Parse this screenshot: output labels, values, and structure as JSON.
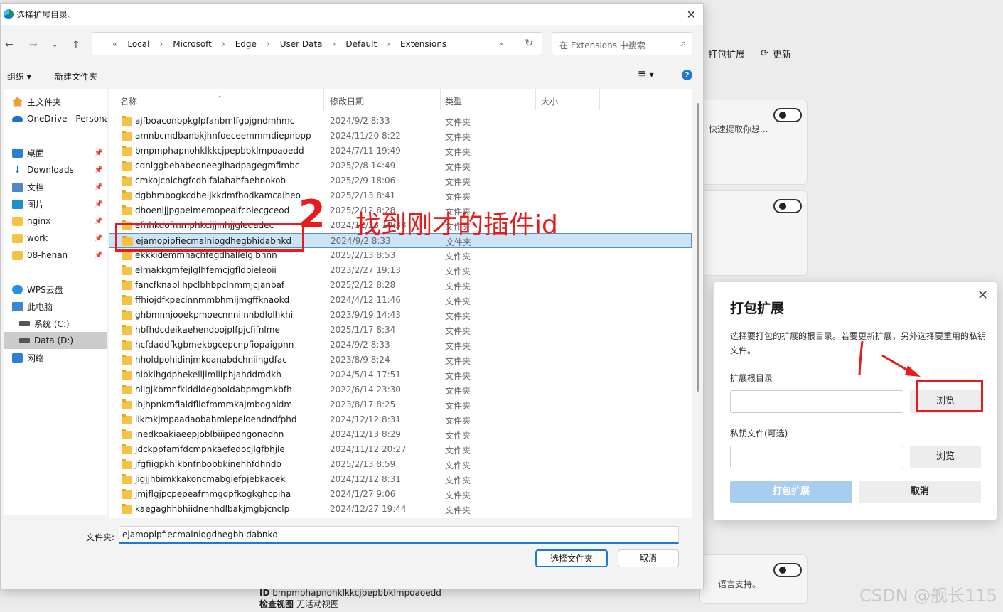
{
  "background": {
    "toolbar": {
      "pack_label": "打包扩展",
      "refresh_label": "更新"
    },
    "card_desc_1": "快速提取你想...",
    "card_desc_last": "语言支持。",
    "bottom_id_label": "ID",
    "bottom_id_value": "bmpmphapnohklkkcjpepbbklmpoaoedd",
    "bottom_view_label": "检查视图",
    "bottom_view_value": "无活动视图",
    "watermark": "CSDN @舰长115"
  },
  "dialog": {
    "title": "选择扩展目录。",
    "breadcrumb": [
      "Local",
      "Microsoft",
      "Edge",
      "User Data",
      "Default",
      "Extensions"
    ],
    "breadcrumb_prefix": "«",
    "search_placeholder": "在 Extensions 中搜索",
    "organize_label": "组织 ▾",
    "new_folder_label": "新建文件夹",
    "columns": {
      "name": "名称",
      "modified": "修改日期",
      "type": "类型",
      "size": "大小"
    },
    "nav": [
      {
        "label": "主文件夹",
        "icon": "home-icon"
      },
      {
        "label": "OneDrive - Personal",
        "icon": "onedrive-icon"
      },
      {
        "label": "桌面",
        "icon": "desktop-icon",
        "pinned": true
      },
      {
        "label": "Downloads",
        "icon": "download-icon",
        "pinned": true
      },
      {
        "label": "文档",
        "icon": "document-icon",
        "pinned": true
      },
      {
        "label": "图片",
        "icon": "pictures-icon",
        "pinned": true
      },
      {
        "label": "nginx",
        "icon": "folder-icon",
        "pinned": true
      },
      {
        "label": "work",
        "icon": "folder-icon",
        "pinned": true
      },
      {
        "label": "08-henan",
        "icon": "folder-icon",
        "pinned": true
      },
      {
        "label": "WPS云盘",
        "icon": "wps-cloud-icon"
      },
      {
        "label": "此电脑",
        "icon": "pc-icon"
      },
      {
        "label": "系统 (C:)",
        "icon": "drive-icon"
      },
      {
        "label": "Data (D:)",
        "icon": "drive-icon",
        "selected": true
      },
      {
        "label": "网络",
        "icon": "network-icon"
      }
    ],
    "files": [
      {
        "name": "ajfboaconbpkglpfanbmlfgojgndmhmc",
        "date": "2024/9/2 8:33",
        "type": "文件夹"
      },
      {
        "name": "amnbcmdbanbkjhnfoeceemmmdiepnbpp",
        "date": "2024/11/20 8:22",
        "type": "文件夹"
      },
      {
        "name": "bmpmphapnohklkkcjpepbbklmpoaoedd",
        "date": "2024/7/11 19:49",
        "type": "文件夹"
      },
      {
        "name": "cdnlggbebabeoneeglhadpagegmflmbc",
        "date": "2025/2/8 14:49",
        "type": "文件夹"
      },
      {
        "name": "cmkojcnichgfcdhlfalahahfaehnokob",
        "date": "2025/2/9 18:06",
        "type": "文件夹"
      },
      {
        "name": "dgbhmbogkcdheijkkdmfhodkamcaiheo",
        "date": "2025/2/13 8:41",
        "type": "文件夹"
      },
      {
        "name": "dhoenijjpgpeimemopealfcbiecgceod",
        "date": "2025/2/12 8:28",
        "type": "文件夹"
      },
      {
        "name": "efnhkdofmmphkcijjinhjjgledadec",
        "date": "2024/12/23 10:38",
        "type": "文件夹"
      },
      {
        "name": "ejamopipfiecmalniogdhegbhidabnkd",
        "date": "2024/9/2 8:33",
        "type": "文件夹",
        "selected": true
      },
      {
        "name": "ekkkidemmhachfegdhallelgibnnn",
        "date": "2025/2/13 8:53",
        "type": "文件夹"
      },
      {
        "name": "elmakkgmfejlglhfemcjgfldbieleoii",
        "date": "2023/2/27 19:13",
        "type": "文件夹"
      },
      {
        "name": "fancfknaplihpclbhbpclnmmjcjanbaf",
        "date": "2025/2/12 8:28",
        "type": "文件夹"
      },
      {
        "name": "ffhiojdfkpecinnmmbhmijmgffknaokd",
        "date": "2024/4/12 11:46",
        "type": "文件夹"
      },
      {
        "name": "ghbmnnjooekpmoecnnnilnnbdlolhkhi",
        "date": "2023/9/19 14:43",
        "type": "文件夹"
      },
      {
        "name": "hbfhdcdeikaehendoojplfpjcfifnlme",
        "date": "2025/1/17 8:34",
        "type": "文件夹"
      },
      {
        "name": "hcfdaddfkgbmekbgcepcnpfiopaigpnn",
        "date": "2024/9/2 8:33",
        "type": "文件夹"
      },
      {
        "name": "hholdpohidinjmkoanabdchniingdfac",
        "date": "2023/8/9 8:24",
        "type": "文件夹"
      },
      {
        "name": "hibkihgdphekeiljimliiphjahddmdkh",
        "date": "2024/5/14 17:51",
        "type": "文件夹"
      },
      {
        "name": "hiigjkbmnfkiddldegboidabpmgmkbfh",
        "date": "2022/6/14 23:30",
        "type": "文件夹"
      },
      {
        "name": "ibjhpnkmfialdfllofmmmkajmboghldm",
        "date": "2023/8/17 8:25",
        "type": "文件夹"
      },
      {
        "name": "iikmkjmpaadaobahmlepeloendndfphd",
        "date": "2024/12/12 8:31",
        "type": "文件夹"
      },
      {
        "name": "inedkoakiaeepjoblbiiipedngonadhn",
        "date": "2024/12/13 8:29",
        "type": "文件夹"
      },
      {
        "name": "jdckppfamfdcmpnkaefedocjlgfbhjle",
        "date": "2024/11/12 20:27",
        "type": "文件夹"
      },
      {
        "name": "jfgfiigpkhlkbnfnbobbkinehhfdhndo",
        "date": "2025/2/13 8:59",
        "type": "文件夹"
      },
      {
        "name": "jigjjhbimkkakoncmabgiefpjebkaoek",
        "date": "2024/12/12 8:31",
        "type": "文件夹"
      },
      {
        "name": "jmjflgjpcpepeafmmgdpfkogkghcpiha",
        "date": "2024/1/27 9:06",
        "type": "文件夹"
      },
      {
        "name": "kaegaghhbhiidnenhdlbakjmgbjcnclp",
        "date": "2024/12/27 19:44",
        "type": "文件夹"
      }
    ],
    "folder_label": "文件夹:",
    "folder_value": "ejamopipfiecmalniogdhegbhidabnkd",
    "select_button": "选择文件夹",
    "cancel_button": "取消"
  },
  "annotation": {
    "step": "2",
    "text": "找到刚才的插件id"
  },
  "pack_dialog": {
    "title": "打包扩展",
    "description": "选择要打包的扩展的根目录。若要更新扩展，另外选择要重用的私钥文件。",
    "root_label": "扩展根目录",
    "key_label": "私钥文件(可选)",
    "browse_label": "浏览",
    "browse_label_2": "浏览",
    "pack_button": "打包扩展",
    "cancel_button": "取消"
  },
  "colors": {
    "accent": "#1e78d7",
    "annotation": "#e51c1c",
    "folder": "#f6c244",
    "selection": "#cce4f7"
  }
}
